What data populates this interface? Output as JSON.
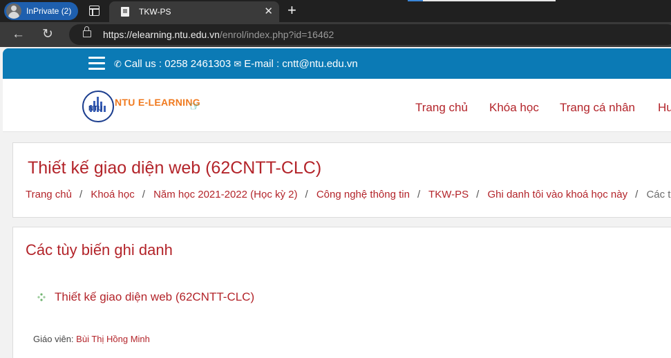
{
  "browser": {
    "inprivate_label": "InPrivate (2)",
    "tab_title": "TKW-PS",
    "tab_close": "✕",
    "new_tab": "+",
    "url_host": "https://elearning.ntu.edu.vn",
    "url_path": "/enrol/index.php?id=16462"
  },
  "topbar": {
    "phone": "Call us : 0258 2461303",
    "email": "E-mail : cntt@ntu.edu.vn"
  },
  "header": {
    "logo_mark": "NTU",
    "logo_text": "NTU E-LEARNING",
    "nav": [
      "Trang chủ",
      "Khóa học",
      "Trang cá nhân",
      "Hư"
    ]
  },
  "course": {
    "title": "Thiết kế giao diện web (62CNTT-CLC)",
    "breadcrumb": [
      "Trang chủ",
      "Khoá học",
      "Năm học 2021-2022 (Học kỳ 2)",
      "Công nghệ thông tin",
      "TKW-PS",
      "Ghi danh tôi vào khoá học này"
    ],
    "breadcrumb_current": "Các tù"
  },
  "enrol": {
    "heading": "Các tùy biến ghi danh",
    "course_link": "Thiết kế giao diện web (62CNTT-CLC)",
    "teacher_label": "Giáo viên:",
    "teacher_name": "Bùi Thị Hồng Minh"
  }
}
